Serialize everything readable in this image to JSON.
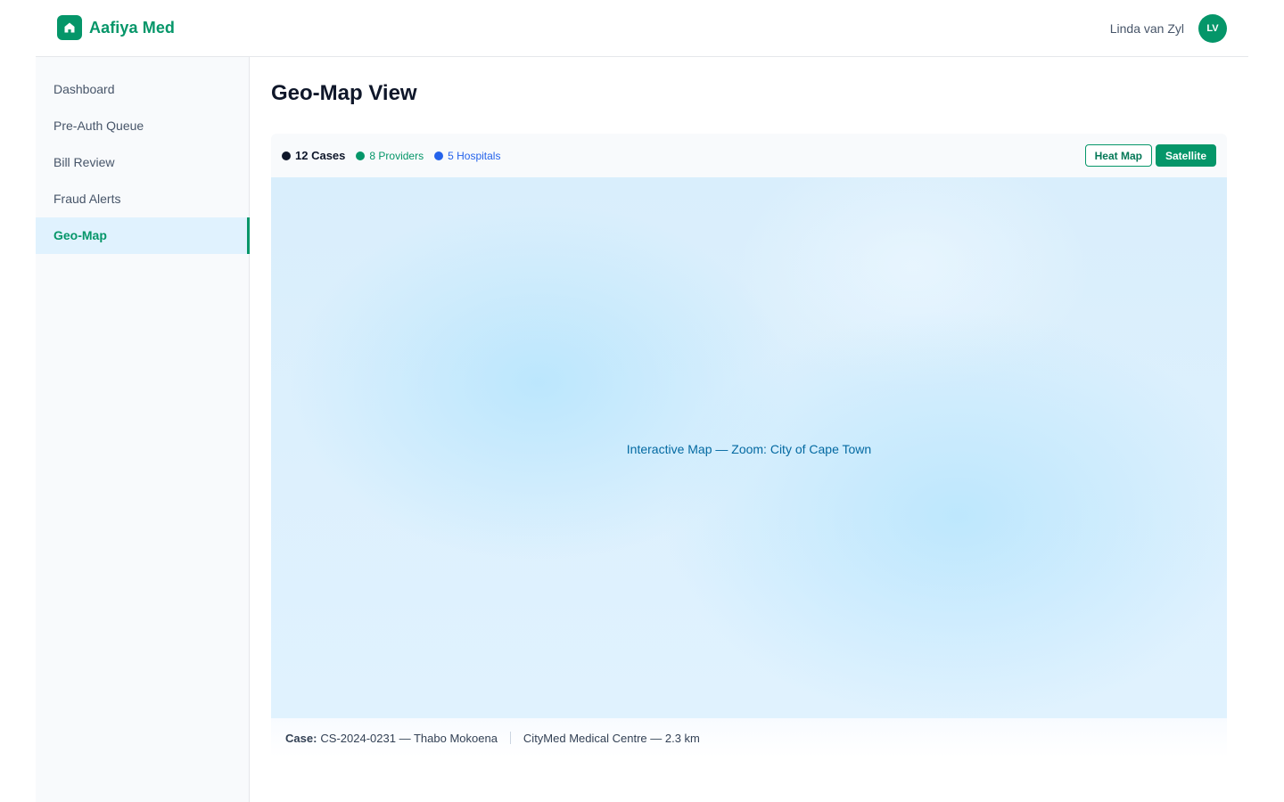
{
  "header": {
    "brand_name": "Aafiya Med",
    "brand_icon": "home-icon",
    "user_name": "Linda van Zyl",
    "user_initials": "LV"
  },
  "sidebar": {
    "items": [
      {
        "label": "Dashboard",
        "active": false
      },
      {
        "label": "Pre-Auth Queue",
        "active": false
      },
      {
        "label": "Bill Review",
        "active": false
      },
      {
        "label": "Fraud Alerts",
        "active": false
      },
      {
        "label": "Geo-Map",
        "active": true
      }
    ]
  },
  "main": {
    "title": "Geo-Map View",
    "legend": {
      "cases": "12 Cases",
      "providers": "8 Providers",
      "hospitals": "5 Hospitals"
    },
    "toggles": {
      "heat_map": "Heat Map",
      "satellite": "Satellite"
    },
    "map_label": "Interactive Map — Zoom: City of Cape Town",
    "case_info": {
      "label": "Case:",
      "case_text": "CS-2024-0231 — Thabo Mokoena",
      "facility_text": "CityMed Medical Centre — 2.3 km"
    }
  },
  "colors": {
    "brand": "#059669",
    "active_bg": "#e0f2fe",
    "cases_dot": "#0f172a",
    "providers_dot": "#059669",
    "hospitals_dot": "#2563eb",
    "map_bg": "#e0f2fe"
  }
}
